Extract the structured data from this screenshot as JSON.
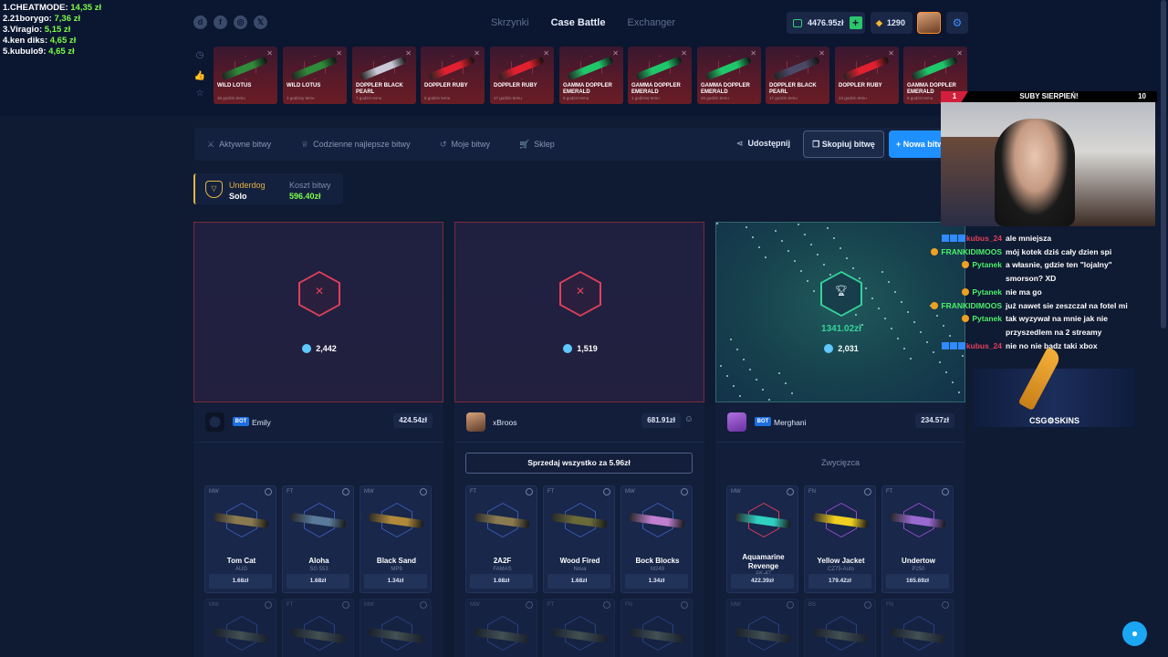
{
  "leaderboard": [
    {
      "name": "1.CHEATMODE:",
      "amount": "14,35 zł"
    },
    {
      "name": "2.21borygo:",
      "amount": "7,36 zł"
    },
    {
      "name": "3.Viragio:",
      "amount": "5,15 zł"
    },
    {
      "name": "4.ken diks:",
      "amount": "4,65 zł"
    },
    {
      "name": "5.kubulo9:",
      "amount": "4,65 zł"
    }
  ],
  "social_icons": [
    "discord-icon",
    "facebook-icon",
    "instagram-icon",
    "x-icon"
  ],
  "nav": {
    "tabs": [
      "Skrzynki",
      "Case Battle",
      "Exchanger"
    ],
    "active": "Case Battle"
  },
  "header": {
    "balance": "4476.95zł",
    "coins": "1290",
    "plus": "+"
  },
  "drops": [
    {
      "name": "WILD LOTUS",
      "sub": "39 godzin temu",
      "color": "#2f8a3a"
    },
    {
      "name": "WILD LOTUS",
      "sub": "3 godziny temu",
      "color": "#2f8a3a"
    },
    {
      "name": "DOPPLER BLACK PEARL",
      "sub": "7 godzin temu",
      "color": "#c9c9d6"
    },
    {
      "name": "DOPPLER RUBY",
      "sub": "5 godzin temu",
      "color": "#e0202e"
    },
    {
      "name": "DOPPLER RUBY",
      "sub": "27 godzin temu",
      "color": "#e0202e"
    },
    {
      "name": "GAMMA DOPPLER EMERALD",
      "sub": "9 godzin temu",
      "color": "#1fc76a"
    },
    {
      "name": "GAMMA DOPPLER EMERALD",
      "sub": "1 godzinę temu",
      "color": "#1fc76a"
    },
    {
      "name": "GAMMA DOPPLER EMERALD",
      "sub": "20 godzin temu",
      "color": "#1fc76a"
    },
    {
      "name": "DOPPLER BLACK PEARL",
      "sub": "17 godzin temu",
      "color": "#4a4a66"
    },
    {
      "name": "DOPPLER RUBY",
      "sub": "23 godzin temu",
      "color": "#e0202e"
    },
    {
      "name": "GAMMA DOPPLER EMERALD",
      "sub": "8 godzin temu",
      "color": "#1fc76a"
    }
  ],
  "tabs": {
    "active": "Aktywne bitwy",
    "daily": "Codzienne najlepsze bitwy",
    "mine": "Moje bitwy",
    "shop": "Sklep",
    "share": "Udostępnij",
    "copy": "Skopiuj bitwę",
    "new": "+  Nowa bitwa"
  },
  "mode": {
    "title": "Underdog",
    "sub": "Solo",
    "cost_label": "Koszt bitwy",
    "cost_value": "596.40zł"
  },
  "players": [
    {
      "score": "2,442",
      "name": "Emily",
      "bot": "BOT",
      "value": "424.54zł",
      "winner": false,
      "winAmount": "",
      "items": [
        {
          "cond": "MW",
          "name": "Tom Cat",
          "type": "AUG",
          "price": "1.68zł",
          "color": "#8a7a50"
        },
        {
          "cond": "FT",
          "name": "Aloha",
          "type": "SG 553",
          "price": "1.68zł",
          "color": "#5a7a9a"
        },
        {
          "cond": "MW",
          "name": "Black Sand",
          "type": "MP9",
          "price": "1.34zł",
          "color": "#b08a3a"
        }
      ]
    },
    {
      "score": "1,519",
      "name": "xBroos",
      "bot": "",
      "value": "681.91zł",
      "winner": false,
      "winAmount": "",
      "sell": "Sprzedaj wszystko za 5.96zł",
      "items": [
        {
          "cond": "FT",
          "name": "2A2F",
          "type": "FAMAS",
          "price": "1.68zł",
          "color": "#8a7a50"
        },
        {
          "cond": "FT",
          "name": "Wood Fired",
          "type": "Nova",
          "price": "1.68zł",
          "color": "#6a6a3a"
        },
        {
          "cond": "MW",
          "name": "Bock Blocks",
          "type": "M249",
          "price": "1.34zł",
          "color": "#c080d0"
        }
      ]
    },
    {
      "score": "2,031",
      "name": "Merghani",
      "bot": "BOT",
      "value": "234.57zł",
      "winner": true,
      "winAmount": "1341.02zł",
      "winnerLabel": "Zwycięzca",
      "items": [
        {
          "cond": "MW",
          "name": "Aquamarine Revenge",
          "type": "AK-47",
          "price": "422.39zł",
          "color": "#2fd0c0"
        },
        {
          "cond": "FN",
          "name": "Yellow Jacket",
          "type": "CZ75-Auto",
          "price": "179.42zł",
          "color": "#f0d020"
        },
        {
          "cond": "FT",
          "name": "Undertow",
          "type": "P250",
          "price": "165.69zł",
          "color": "#9a6ad0"
        }
      ]
    }
  ],
  "row2conds": [
    [
      "MW",
      "FT",
      "MW"
    ],
    [
      "MW",
      "FT",
      "FN"
    ],
    [
      "MW",
      "BS",
      "FN"
    ]
  ],
  "overlay": {
    "subs_title": "SUBY SIERPIEŃ!",
    "subs_left": "1",
    "subs_right": "10",
    "chat": [
      {
        "user": "kubus_24",
        "color": "#e0405a",
        "msg": "ale mniejsza",
        "badges": true
      },
      {
        "user": "FRANKIDIMOOS",
        "color": "#4cf06a",
        "msg": "mój kotek dziś cały dzien spi",
        "badges": false
      },
      {
        "user": "Pytanek",
        "color": "#4cf06a",
        "msg": "a własnie, gdzie ten \"lojalny\"",
        "cont": "smorson? XD",
        "badges": false
      },
      {
        "user": "Pytanek",
        "color": "#4cf06a",
        "msg": "nie ma go",
        "badges": false
      },
      {
        "user": "FRANKIDIMOOS",
        "color": "#4cf06a",
        "msg": "już nawet sie zeszczał na fotel mi",
        "badges": false
      },
      {
        "user": "Pytanek",
        "color": "#4cf06a",
        "msg": "tak wyzywał na mnie jak nie",
        "cont": "przyszedlem na 2 streamy",
        "badges": false
      },
      {
        "user": "kubus_24",
        "color": "#e0405a",
        "msg": "nie no nie badz taki xbox",
        "badges": true
      }
    ],
    "sponsor": "CSG⚙SKINS"
  }
}
